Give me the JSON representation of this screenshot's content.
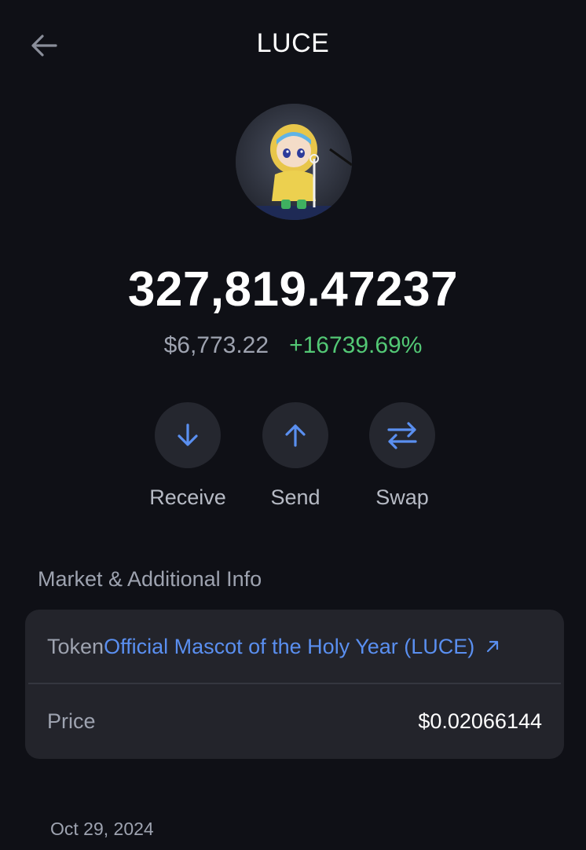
{
  "header": {
    "title": "LUCE",
    "back_icon": "arrow-left-icon"
  },
  "token": {
    "avatar": "luce-mascot-avatar",
    "balance": "327,819.47237",
    "fiat_value": "$6,773.22",
    "change": "+16739.69%"
  },
  "actions": [
    {
      "label": "Receive",
      "icon": "arrow-down-icon"
    },
    {
      "label": "Send",
      "icon": "arrow-up-icon"
    },
    {
      "label": "Swap",
      "icon": "swap-arrows-icon"
    }
  ],
  "info": {
    "section_title": "Market & Additional Info",
    "token_key": "Token",
    "token_value": "Official Mascot of the Holy Year (LUCE)",
    "external_icon": "external-link-icon",
    "price_key": "Price",
    "price_value": "$0.02066144"
  },
  "history": {
    "date": "Oct 29, 2024"
  },
  "colors": {
    "background": "#0f1016",
    "card": "#23242b",
    "accent": "#5a8ff0",
    "positive": "#53c875",
    "muted": "#9ea3b0"
  }
}
